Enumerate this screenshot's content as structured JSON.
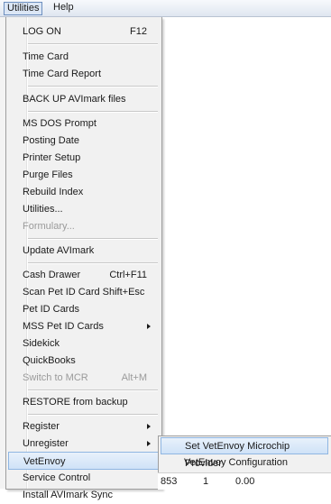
{
  "menubar": {
    "utilities": "Utilities",
    "help": "Help"
  },
  "menu": {
    "items": [
      {
        "label": "LOG ON",
        "shortcut": "F12"
      },
      {
        "label": "Time Card"
      },
      {
        "label": "Time Card Report"
      },
      {
        "label": "BACK UP AVImark files"
      },
      {
        "label": "MS DOS Prompt"
      },
      {
        "label": "Posting Date"
      },
      {
        "label": "Printer Setup"
      },
      {
        "label": "Purge Files"
      },
      {
        "label": "Rebuild Index"
      },
      {
        "label": "Utilities..."
      },
      {
        "label": "Formulary...",
        "disabled": true
      },
      {
        "label": "Update AVImark"
      },
      {
        "label": "Cash Drawer",
        "shortcut": "Ctrl+F11"
      },
      {
        "label": "Scan Pet ID Card Shift+Esc"
      },
      {
        "label": "Pet ID Cards"
      },
      {
        "label": "MSS Pet ID Cards",
        "submenu": true
      },
      {
        "label": "Sidekick"
      },
      {
        "label": "QuickBooks"
      },
      {
        "label": "Switch to MCR",
        "shortcut": "Alt+M",
        "disabled": true
      },
      {
        "label": "RESTORE from backup"
      },
      {
        "label": "Register",
        "submenu": true
      },
      {
        "label": "Unregister",
        "submenu": true
      },
      {
        "label": "VetEnvoy",
        "submenu": true,
        "highlighted": true
      },
      {
        "label": "Service Control"
      },
      {
        "label": "Install AVImark Sync"
      }
    ]
  },
  "submenu": {
    "items": [
      {
        "label": "Set VetEnvoy Microchip Provider",
        "highlighted": true
      },
      {
        "label": "VetEnvoy Configuration"
      }
    ]
  },
  "background_cells": {
    "c1": "853",
    "c2": "1",
    "c3": "0.00"
  }
}
